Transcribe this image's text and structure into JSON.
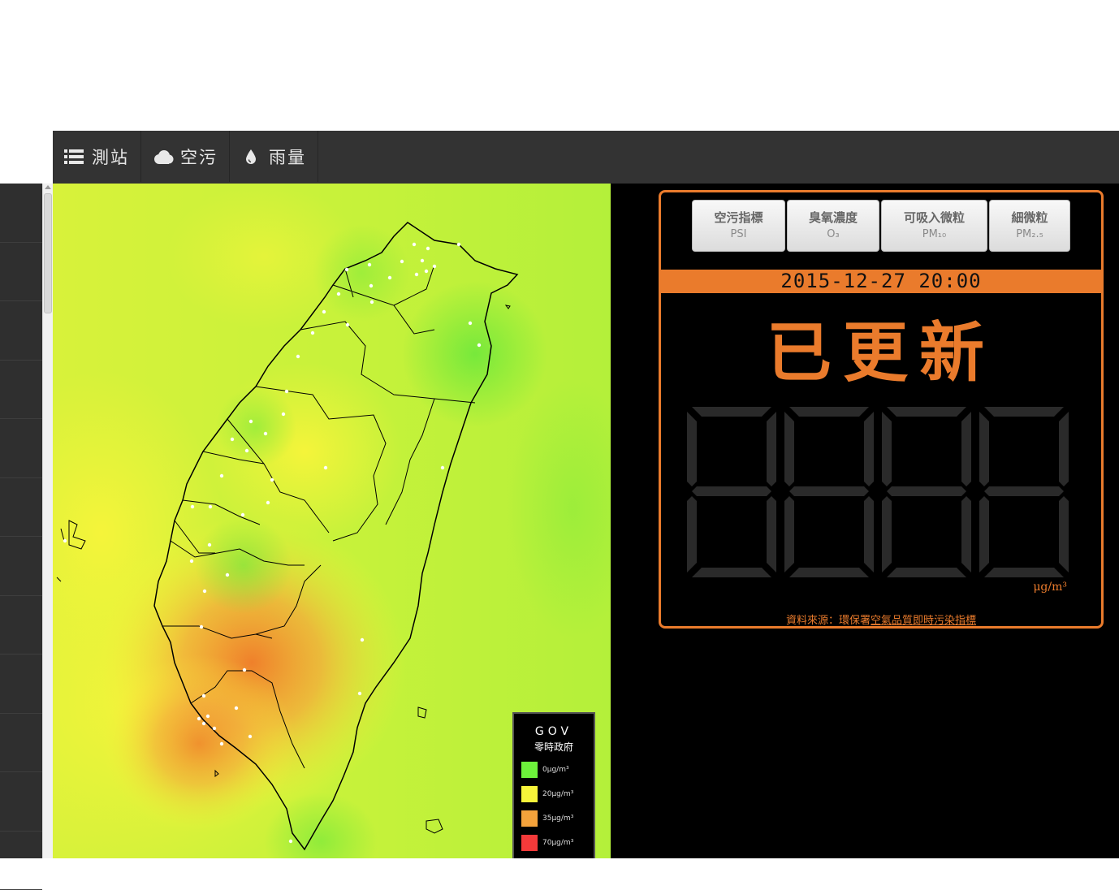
{
  "navbar": {
    "items": [
      {
        "label": "測站",
        "icon": "list-icon"
      },
      {
        "label": "空污",
        "icon": "cloud-icon"
      },
      {
        "label": "雨量",
        "icon": "drop-icon"
      }
    ]
  },
  "legend": {
    "logo_text": "GOV",
    "logo_sub": "零時政府",
    "entries": [
      {
        "label": "0μg/m³",
        "color": "#6df23b"
      },
      {
        "label": "20μg/m³",
        "color": "#f7f43a"
      },
      {
        "label": "35μg/m³",
        "color": "#f4a23b"
      },
      {
        "label": "70μg/m³",
        "color": "#f43a3a"
      }
    ]
  },
  "panel": {
    "tabs": [
      {
        "title": "空污指標",
        "sub": "PSI"
      },
      {
        "title": "臭氧濃度",
        "sub": "O₃"
      },
      {
        "title": "可吸入微粒",
        "sub": "PM₁₀"
      },
      {
        "title": "細微粒",
        "sub": "PM₂.₅"
      }
    ],
    "datetime": "2015-12-27 20:00",
    "status": "已更新",
    "unit": "μg/m³",
    "source_prefix": "資料來源：環保署",
    "source_link": "空氣品質即時污染指標"
  },
  "colors": {
    "accent": "#ea7b2c",
    "navbar": "#333333",
    "panel_bg": "#000000"
  }
}
